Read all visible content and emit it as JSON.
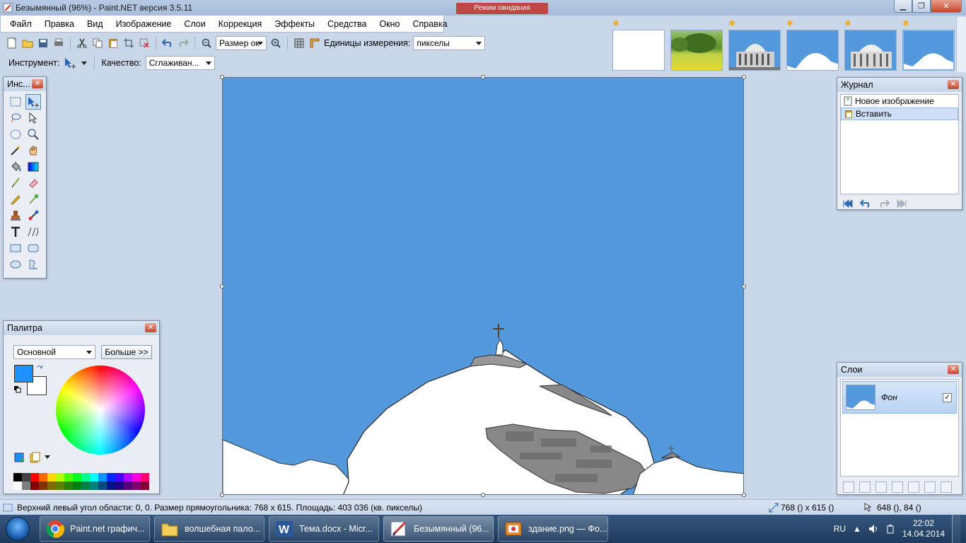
{
  "window": {
    "title": "Безымянный (96%) - Paint.NET версия 3.5.11",
    "ghost_title": "Режим ожидания"
  },
  "menu": [
    "Файл",
    "Правка",
    "Вид",
    "Изображение",
    "Слои",
    "Коррекция",
    "Эффекты",
    "Средства",
    "Окно",
    "Справка"
  ],
  "toolbar": {
    "zoom_value": "Размер ок",
    "units_label": "Единицы измерения:",
    "units_value": "пикселы",
    "tool_label": "Инструмент:",
    "quality_label": "Качество:",
    "quality_value": "Сглаживан..."
  },
  "thumbnails": [
    "blank",
    "meadow",
    "building",
    "dome-cut",
    "building-2",
    "dome-current"
  ],
  "tools_panel": {
    "title": "Инс..."
  },
  "history": {
    "title": "Журнал",
    "items": [
      {
        "label": "Новое изображение",
        "icon": "new-image-icon"
      },
      {
        "label": "Вставить",
        "icon": "paste-icon"
      }
    ]
  },
  "layers": {
    "title": "Слои",
    "items": [
      {
        "name": "Фон",
        "visible": true
      }
    ]
  },
  "palette": {
    "title": "Палитра",
    "mode": "Основной",
    "more_button": "Больше >>",
    "primary_color": "#1e90ff",
    "secondary_color": "#ffffff"
  },
  "status": {
    "selection_text": "Верхний левый угол области: 0, 0. Размер прямоугольника: 768 x 615. Площадь: 403 036 (кв. пикселы)",
    "image_size": "768 () x 615 ()",
    "cursor_pos": "648 (), 84 ()"
  },
  "taskbar": {
    "items": [
      {
        "label": "Paint.net графич...",
        "icon": "chrome-icon"
      },
      {
        "label": "волшебная пало...",
        "icon": "folder-icon"
      },
      {
        "label": "Тема.docx - Micr...",
        "icon": "word-icon"
      },
      {
        "label": "Безымянный (96...",
        "icon": "paintnet-icon",
        "active": true
      },
      {
        "label": "здание.png — Фо...",
        "icon": "photo-viewer-icon"
      }
    ],
    "lang": "RU",
    "time": "22:02",
    "date": "14.04.2014"
  },
  "colors": {
    "canvas_sky": "#5599dd",
    "accent": "#1e90ff"
  }
}
